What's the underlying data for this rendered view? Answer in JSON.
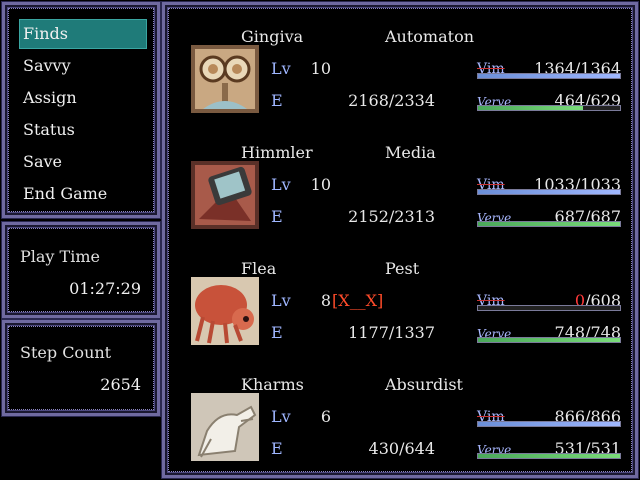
{
  "menu": {
    "items": [
      {
        "label": "Finds",
        "selected": true
      },
      {
        "label": "Savvy",
        "selected": false
      },
      {
        "label": "Assign",
        "selected": false
      },
      {
        "label": "Status",
        "selected": false
      },
      {
        "label": "Save",
        "selected": false
      },
      {
        "label": "End Game",
        "selected": false
      }
    ]
  },
  "playtime": {
    "label": "Play Time",
    "value": "01:27:29"
  },
  "steps": {
    "label": "Step Count",
    "value": "2654"
  },
  "labels": {
    "lv": "Lv",
    "e": "E",
    "vim": "Vim",
    "verve": "Verve"
  },
  "party": [
    {
      "name": "Gingiva",
      "class": "Automaton",
      "level": "10",
      "status": "",
      "exp": "2168/2334",
      "vim_cur": "1364",
      "vim_max": "/1364",
      "vim_frac": 1.0,
      "verve_cur": "464",
      "verve_max": "/629",
      "verve_frac": 0.74,
      "portrait": "spectacles-portrait-icon"
    },
    {
      "name": "Himmler",
      "class": "Media",
      "level": "10",
      "status": "",
      "exp": "2152/2313",
      "vim_cur": "1033",
      "vim_max": "/1033",
      "vim_frac": 1.0,
      "verve_cur": "687",
      "verve_max": "/687",
      "verve_frac": 1.0,
      "portrait": "tv-head-portrait-icon"
    },
    {
      "name": "Flea",
      "class": "Pest",
      "level": "8",
      "status": "[X__X]",
      "exp": "1177/1337",
      "vim_cur": "0",
      "vim_max": "/608",
      "vim_frac": 0.0,
      "verve_cur": "748",
      "verve_max": "/748",
      "verve_frac": 1.0,
      "portrait": "flea-portrait-icon"
    },
    {
      "name": "Kharms",
      "class": "Absurdist",
      "level": "6",
      "status": "",
      "exp": "430/644",
      "vim_cur": "866",
      "vim_max": "/866",
      "vim_frac": 1.0,
      "verve_cur": "531",
      "verve_max": "/531",
      "verve_frac": 1.0,
      "portrait": "hand-portrait-icon"
    }
  ]
}
